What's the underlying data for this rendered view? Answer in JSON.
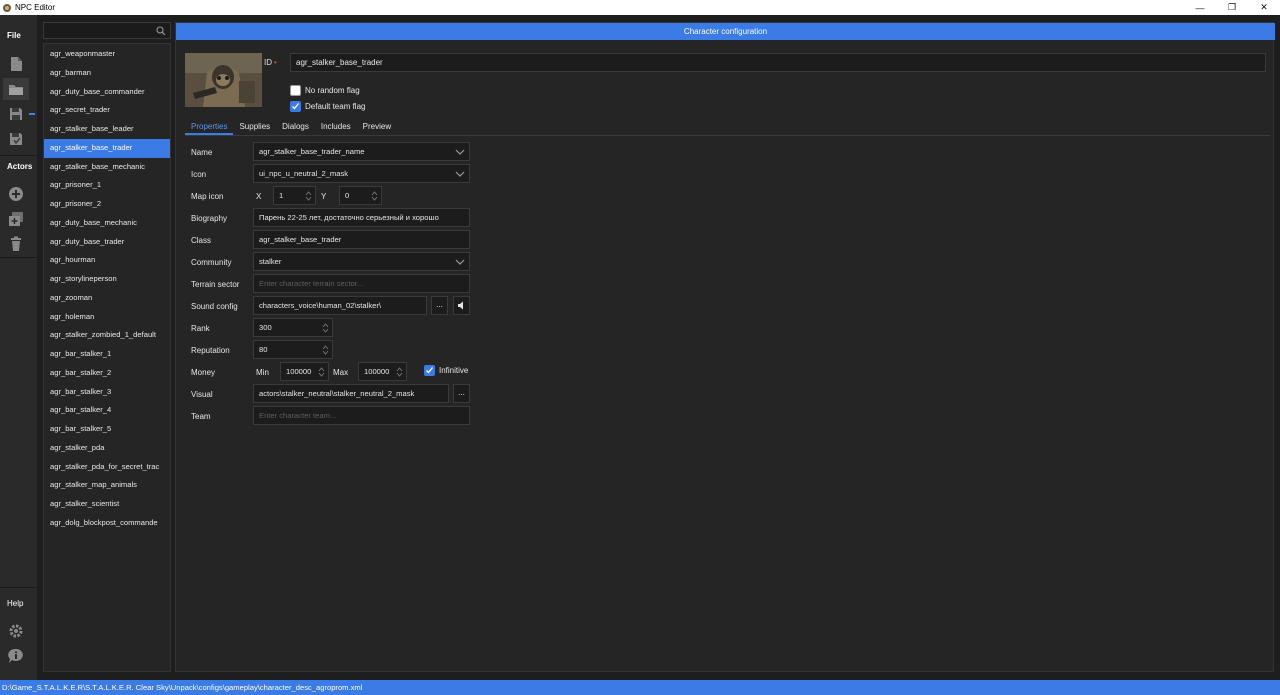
{
  "window": {
    "title": "NPC Editor",
    "controls": {
      "minimize": "—",
      "maximize": "❐",
      "close": "✕"
    }
  },
  "rail": {
    "file_label": "File",
    "actors_label": "Actors",
    "help_label": "Help",
    "icons": [
      "new-file-icon",
      "open-folder-icon",
      "save-icon",
      "save-as-icon",
      "add-actor-icon",
      "duplicate-actor-icon",
      "delete-actor-icon",
      "settings-icon",
      "info-icon"
    ]
  },
  "search": {
    "value": "",
    "placeholder": ""
  },
  "actors": [
    "agr_weaponmaster",
    "agr_barman",
    "agr_duty_base_commander",
    "agr_secret_trader",
    "agr_stalker_base_leader",
    "agr_stalker_base_trader",
    "agr_stalker_base_mechanic",
    "agr_prisoner_1",
    "agr_prisoner_2",
    "agr_duty_base_mechanic",
    "agr_duty_base_trader",
    "agr_hourman",
    "agr_storylineperson",
    "agr_zooman",
    "agr_holeman",
    "agr_stalker_zombied_1_default",
    "agr_bar_stalker_1",
    "agr_bar_stalker_2",
    "agr_bar_stalker_3",
    "agr_bar_stalker_4",
    "agr_bar_stalker_5",
    "agr_stalker_pda",
    "agr_stalker_pda_for_secret_trac",
    "agr_stalker_map_animals",
    "agr_stalker_scientist",
    "agr_dolg_blockpost_commande"
  ],
  "selected_index": 5,
  "main": {
    "header": "Character configuration",
    "id_label": "ID",
    "id_required_marker": "•",
    "id_value": "agr_stalker_base_trader",
    "no_random_flag": {
      "label": "No random flag",
      "checked": false
    },
    "default_team_flag": {
      "label": "Default team flag",
      "checked": true
    },
    "tabs": [
      "Properties",
      "Supplies",
      "Dialogs",
      "Includes",
      "Preview"
    ],
    "active_tab": "Properties"
  },
  "form": {
    "name": {
      "label": "Name",
      "value": "agr_stalker_base_trader_name"
    },
    "icon": {
      "label": "Icon",
      "value": "ui_npc_u_neutral_2_mask"
    },
    "map_icon": {
      "label": "Map icon",
      "x_label": "X",
      "x_value": "1",
      "y_label": "Y",
      "y_value": "0"
    },
    "biography": {
      "label": "Biography",
      "value": "Парень 22-25 лет, достаточно серьезный и хорошо"
    },
    "class": {
      "label": "Class",
      "value": "agr_stalker_base_trader"
    },
    "community": {
      "label": "Community",
      "value": "stalker"
    },
    "terrain_sector": {
      "label": "Terrain sector",
      "placeholder": "Enter character terrain sector..."
    },
    "sound_config": {
      "label": "Sound config",
      "value": "characters_voice\\human_02\\stalker\\",
      "browse": "..."
    },
    "rank": {
      "label": "Rank",
      "value": "300"
    },
    "reputation": {
      "label": "Reputation",
      "value": "80"
    },
    "money": {
      "label": "Money",
      "min_label": "Min",
      "min_value": "100000",
      "max_label": "Max",
      "max_value": "100000",
      "infinitive_label": "Infinitive",
      "infinitive_checked": true
    },
    "visual": {
      "label": "Visual",
      "value": "actors\\stalker_neutral\\stalker_neutral_2_mask",
      "browse": "..."
    },
    "team": {
      "label": "Team",
      "placeholder": "Enter character team..."
    }
  },
  "statusbar": "D:\\Game_S.T.A.L.K.E.R\\S.T.A.L.K.E.R. Clear Sky\\Unpack\\configs\\gameplay\\character_desc_agroprom.xml",
  "colors": {
    "accent": "#3a7be6",
    "background": "#1e1e1e",
    "panel": "#252526",
    "required": "#e04848"
  }
}
